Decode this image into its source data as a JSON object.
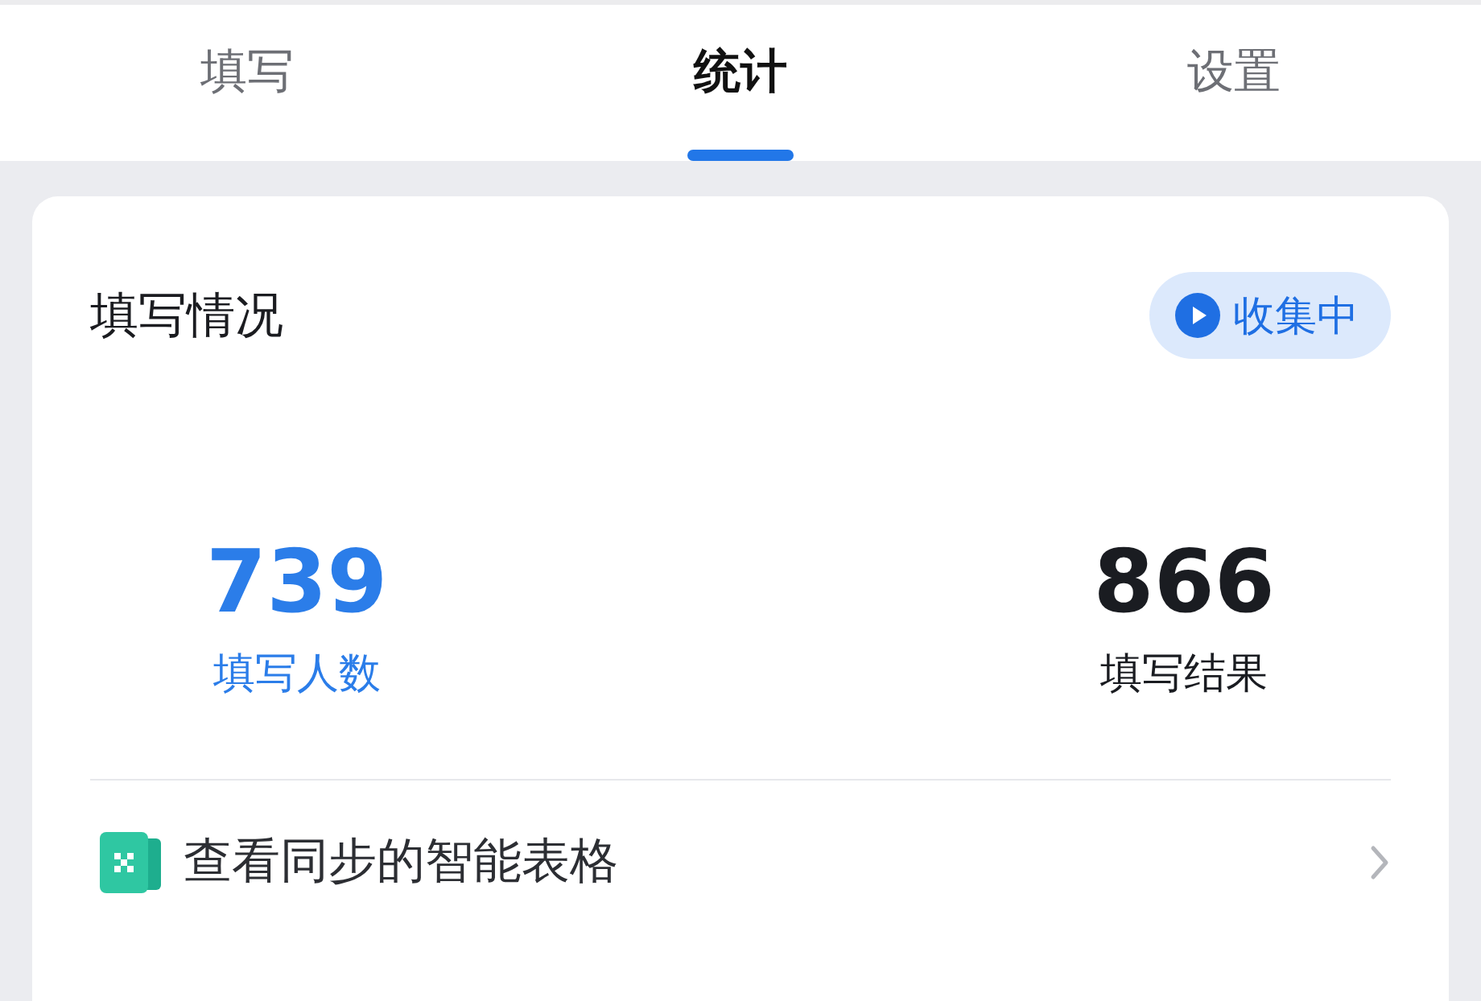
{
  "tabs": [
    {
      "label": "填写",
      "selected": false
    },
    {
      "label": "统计",
      "selected": true
    },
    {
      "label": "设置",
      "selected": false
    }
  ],
  "summary": {
    "title": "填写情况",
    "status": "收集中",
    "stats": [
      {
        "value": "739",
        "label": "填写人数",
        "color": "#2b7de9"
      },
      {
        "value": "866",
        "label": "填写结果",
        "color": "#1a1c21"
      }
    ],
    "link": "查看同步的智能表格"
  }
}
